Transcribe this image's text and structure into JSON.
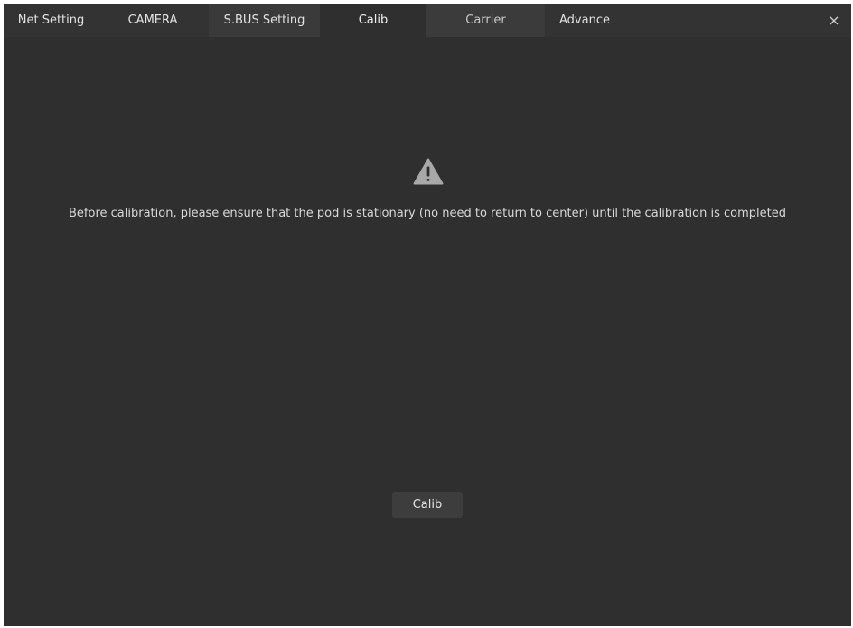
{
  "tabs": [
    {
      "label": "Net Setting"
    },
    {
      "label": "CAMERA"
    },
    {
      "label": "S.BUS Setting"
    },
    {
      "label": "Calib"
    },
    {
      "label": "Carrier"
    },
    {
      "label": "Advance"
    }
  ],
  "active_tab": "Calib",
  "close_glyph": "×",
  "calib_panel": {
    "icon": "warning-triangle-icon",
    "message": "Before calibration, please ensure that the pod is stationary (no need to return to center) until the calibration is completed",
    "button_label": "Calib"
  },
  "colors": {
    "background": "#2f2f2f",
    "tab_bar": "#333333",
    "text": "#d8d8d8",
    "icon": "#a8a8a8"
  }
}
